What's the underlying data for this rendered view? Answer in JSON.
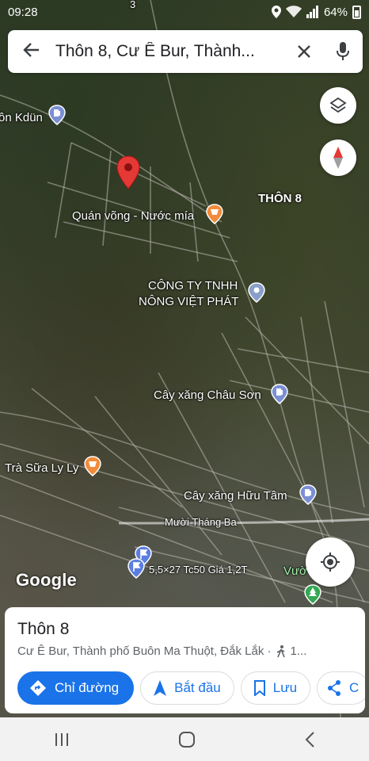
{
  "status": {
    "time": "09:28",
    "battery": "64%"
  },
  "search": {
    "query": "Thôn 8, Cư Ê Bur, Thành..."
  },
  "map": {
    "labels": {
      "kdun": "ôn Kdün",
      "thon8": "THÔN 8",
      "quan_vong": "Quán võng - Nước mía",
      "company_line1": "CÔNG TY TNHH",
      "company_line2": "NÔNG VIỆT PHÁT",
      "cay_xang_chau_son": "Cây xăng Châu Sơn",
      "tra_sua": "Trà Sữa Ly Ly",
      "cay_xang_huu_tam": "Cây xăng Hữu Tâm",
      "road_muoi_thang_ba": "Mười Tháng Ba",
      "land_listing": "5,5×27 Tc50 Giá 1,2T",
      "vuon": "Vườ",
      "top_marker": "3"
    },
    "attribution": "Google"
  },
  "place": {
    "title": "Thôn 8",
    "subtitle": "Cư Ê Bur, Thành phố Buôn Ma Thuột, Đắk Lắk ·",
    "walk_time": "1...",
    "actions": {
      "directions": "Chỉ đường",
      "start": "Bắt đầu",
      "save": "Lưu",
      "share": "C"
    }
  },
  "colors": {
    "accent": "#1a73e8",
    "pin_red": "#e53935",
    "poi_blue": "#7b8fd4",
    "poi_orange": "#f28b3a",
    "park_green": "#34a853"
  }
}
